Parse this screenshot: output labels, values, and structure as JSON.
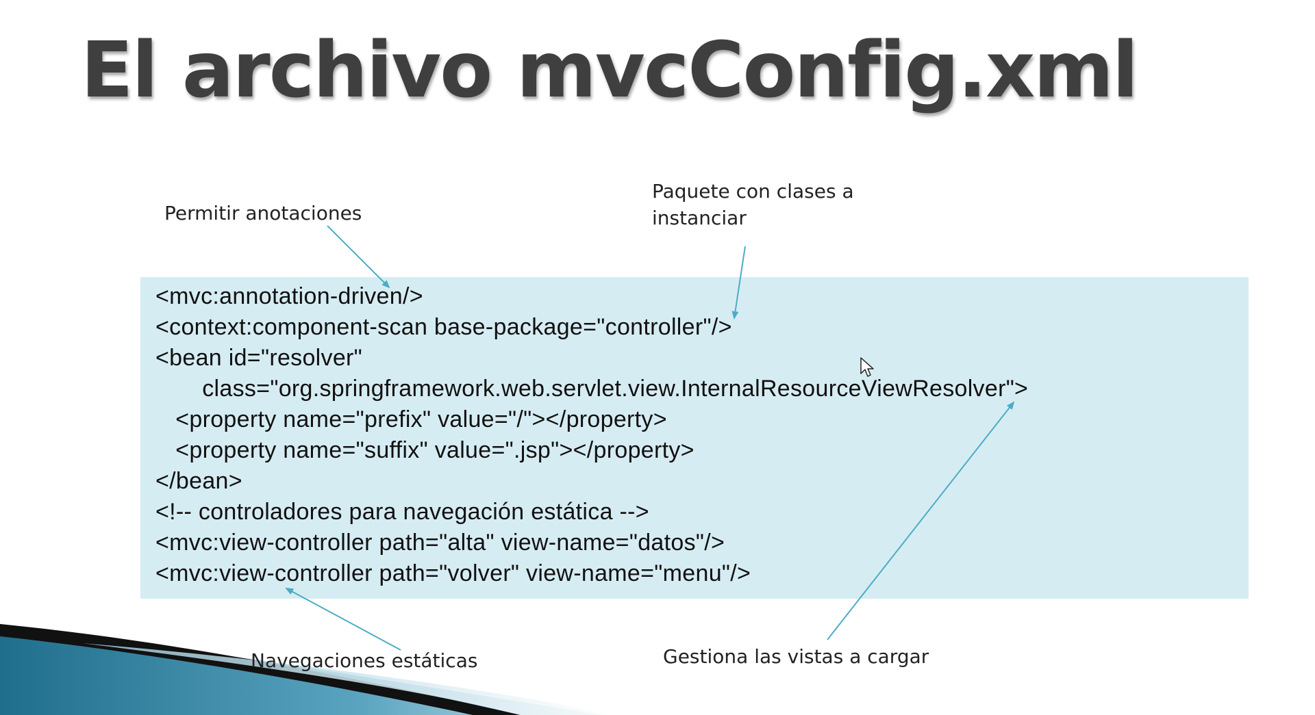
{
  "slide": {
    "title": "El archivo mvcConfig.xml"
  },
  "code": {
    "lines": [
      "<mvc:annotation-driven/>",
      "<context:component-scan base-package=\"controller\"/>",
      "<bean id=\"resolver\"",
      "       class=\"org.springframework.web.servlet.view.InternalResourceViewResolver\">",
      "   <property name=\"prefix\" value=\"/\"></property>",
      "   <property name=\"suffix\" value=\".jsp\"></property>",
      "</bean>",
      "<!-- controladores para navegación estática -->",
      "<mvc:view-controller path=\"alta\" view-name=\"datos\"/>",
      "<mvc:view-controller path=\"volver\" view-name=\"menu\"/>"
    ]
  },
  "annotations": {
    "annotations_label": "Permitir anotaciones",
    "package_label": "Paquete con clases a instanciar",
    "static_nav_label": "Navegaciones estáticas",
    "views_label": "Gestiona las vistas a cargar"
  },
  "colors": {
    "code_background": "#d6ecf3",
    "arrow": "#4bacc6",
    "title": "#3f3f3f",
    "swoosh_dark": "#1f6e8c",
    "swoosh_black": "#111111"
  },
  "icons": {
    "cursor": "mouse-pointer-icon"
  }
}
